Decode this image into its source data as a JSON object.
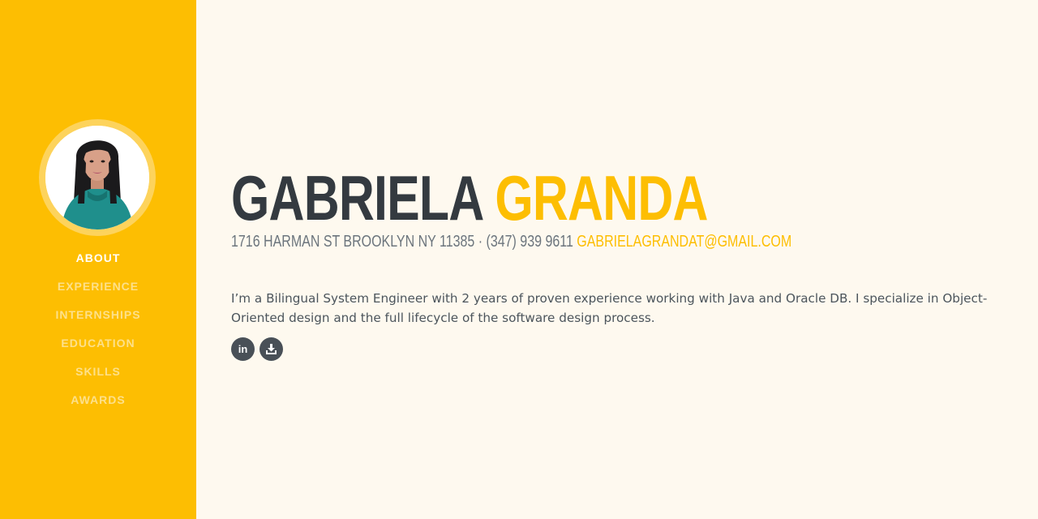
{
  "profile": {
    "photo_alt": "profile photo"
  },
  "nav": {
    "items": [
      {
        "label": "ABOUT"
      },
      {
        "label": "EXPERIENCE"
      },
      {
        "label": "INTERNSHIPS"
      },
      {
        "label": "EDUCATION"
      },
      {
        "label": "SKILLS"
      },
      {
        "label": "AWARDS"
      }
    ]
  },
  "header": {
    "first_name": "GABRIELA",
    "last_name": "GRANDA",
    "address": "1716 HARMAN ST BROOKLYN NY 11385 · (347) 939 9611 ",
    "email": "GABRIELAGRANDAT@GMAIL.COM"
  },
  "about": {
    "text": "I’m a Bilingual System Engineer with 2 years of proven experience working with Java and Oracle DB. I specialize in Object-Oriented design and the full lifecycle of the software design process."
  },
  "social": {
    "linkedin_icon": "linkedin-icon",
    "download_icon": "download-icon",
    "linkedin_glyph": "in"
  },
  "colors": {
    "primary": "#fdbe02",
    "sidebar_bg": "#fdbe02",
    "page_bg": "#fef9ef",
    "heading": "#343a40",
    "text": "#6c757d",
    "button": "#495057"
  }
}
